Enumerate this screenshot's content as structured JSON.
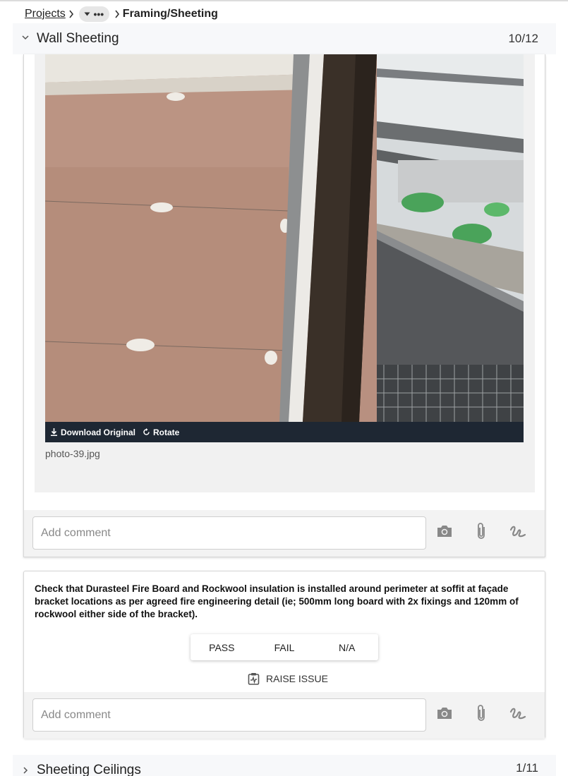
{
  "breadcrumb": {
    "projects": "Projects",
    "more": "•••",
    "current": "Framing/Sheeting"
  },
  "sections": [
    {
      "title": "Wall Sheeting",
      "count": "10/12",
      "expanded": true
    },
    {
      "title": "Sheeting Ceilings",
      "count": "1/11",
      "expanded": false
    }
  ],
  "photo": {
    "download_label": "Download Original",
    "rotate_label": "Rotate",
    "filename": "photo-39.jpg"
  },
  "comment": {
    "placeholder": "Add comment"
  },
  "question": {
    "text": "Check that Durasteel Fire Board and Rockwool insulation is installed around perimeter at soffit at façade bracket locations as per agreed fire engineering detail (ie; 500mm long board with 2x fixings and 120mm of rockwool either side of the bracket).",
    "options": [
      "PASS",
      "FAIL",
      "N/A"
    ],
    "raise_issue": "RAISE ISSUE"
  },
  "icons": [
    "chevron-right-icon",
    "chevron-down-icon",
    "ellipsis-icon",
    "download-icon",
    "rotate-icon",
    "camera-icon",
    "paperclip-icon",
    "signature-icon",
    "clipboard-icon"
  ]
}
